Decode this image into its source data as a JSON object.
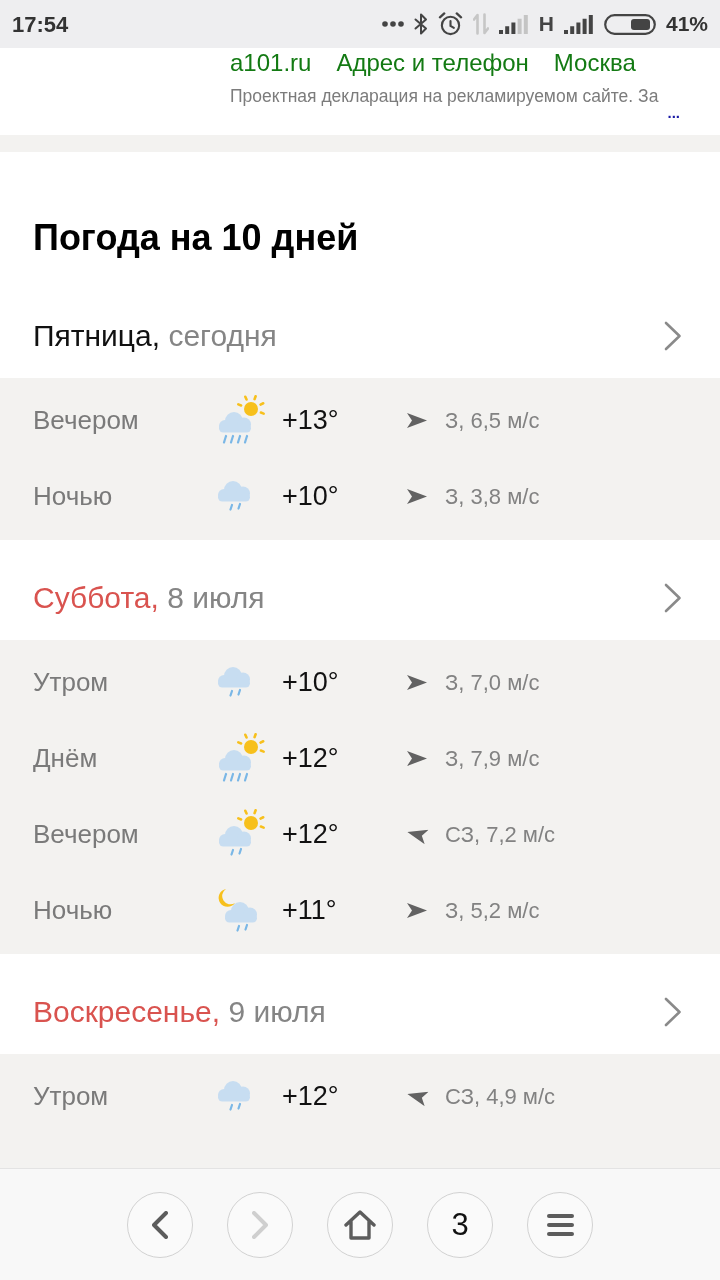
{
  "status_bar": {
    "time": "17:54",
    "network": "H",
    "battery": "41%"
  },
  "ad": {
    "links": [
      "a101.ru",
      "Адрес и телефон",
      "Москва"
    ],
    "disclaimer": "Проектная декларация на рекламируемом сайте. За",
    "more": "..."
  },
  "forecast": {
    "title": "Погода на 10 дней",
    "days": [
      {
        "name": "Пятница,",
        "date": "сегодня",
        "weekend": false,
        "periods": [
          {
            "label": "Вечером",
            "icon": {
              "kind": "sunshower"
            },
            "temperature": "+13°",
            "wind": {
              "kind": "east",
              "reading": "З, 6,5 м/с"
            }
          },
          {
            "label": "Ночью",
            "icon": {
              "kind": "drizzle"
            },
            "temperature": "+10°",
            "wind": {
              "kind": "east",
              "reading": "З, 3,8 м/с"
            }
          }
        ]
      },
      {
        "name": "Суббота,",
        "date": "8 июля",
        "weekend": true,
        "periods": [
          {
            "label": "Утром",
            "icon": {
              "kind": "drizzle"
            },
            "temperature": "+10°",
            "wind": {
              "kind": "east",
              "reading": "З, 7,0 м/с"
            }
          },
          {
            "label": "Днём",
            "icon": {
              "kind": "sunshower"
            },
            "temperature": "+12°",
            "wind": {
              "kind": "east",
              "reading": "З, 7,9 м/с"
            }
          },
          {
            "label": "Вечером",
            "icon": {
              "kind": "sundrizzle"
            },
            "temperature": "+12°",
            "wind": {
              "kind": "northwest",
              "reading": "СЗ, 7,2 м/с"
            }
          },
          {
            "label": "Ночью",
            "icon": {
              "kind": "nightdrizzle"
            },
            "temperature": "+11°",
            "wind": {
              "kind": "east",
              "reading": "З, 5,2 м/с"
            }
          }
        ]
      },
      {
        "name": "Воскресенье,",
        "date": "9 июля",
        "weekend": true,
        "periods": [
          {
            "label": "Утром",
            "icon": {
              "kind": "drizzle"
            },
            "temperature": "+12°",
            "wind": {
              "kind": "northwest",
              "reading": "СЗ, 4,9 м/с"
            }
          }
        ]
      }
    ]
  },
  "toolbar": {
    "buttons": [
      {
        "kind": "back",
        "disabled": false
      },
      {
        "kind": "forward",
        "disabled": true
      },
      {
        "kind": "home",
        "disabled": false
      },
      {
        "kind": "tabs",
        "label": "3",
        "disabled": false
      },
      {
        "kind": "menu",
        "disabled": false
      }
    ]
  }
}
